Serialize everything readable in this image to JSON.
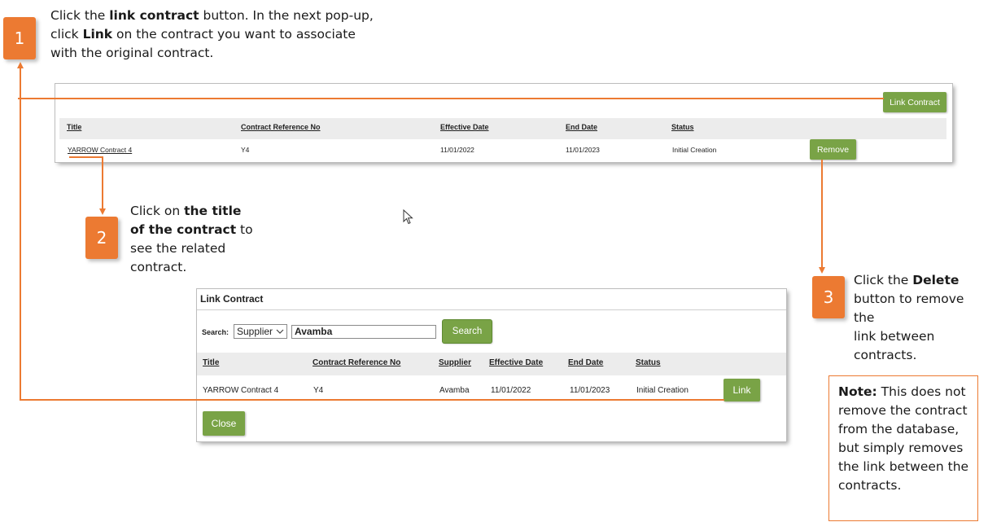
{
  "step1": {
    "number": "1",
    "line1_pre": "Click the ",
    "line1_bold": "link contract",
    "line1_post": " button. In the next pop-up,",
    "line2_pre": "click ",
    "line2_bold": "Link",
    "line2_post": " on the contract you want to associate",
    "line3": "with the original contract."
  },
  "step2": {
    "number": "2",
    "line1_pre": "Click on ",
    "line1_bold": "the title",
    "line2_bold": "of the contract",
    "line2_post": " to",
    "line3": "see the related",
    "line4": "contract."
  },
  "step3": {
    "number": "3",
    "line1_pre": "Click the ",
    "line1_bold": "Delete",
    "line2": "button to remove the",
    "line3": "link between",
    "line4": "contracts."
  },
  "note": {
    "bold": "Note:",
    "line1_post": " This does not",
    "line2": "remove the contract",
    "line3": "from the database,",
    "line4": "but simply removes",
    "line5": "the link between the",
    "line6": "contracts."
  },
  "top_panel": {
    "link_contract_button": "Link Contract",
    "headers": [
      "Title",
      "Contract Reference No",
      "Effective Date",
      "End Date",
      "Status"
    ],
    "row": {
      "title": "YARROW Contract 4",
      "ref": "Y4",
      "effective": "11/01/2022",
      "end": "11/01/2023",
      "status": "Initial Creation",
      "remove_button": "Remove"
    }
  },
  "dialog": {
    "title": "Link Contract",
    "search_label": "Search:",
    "search_field_selected": "Supplier",
    "search_value": "Avamba",
    "search_button": "Search",
    "headers": [
      "Title",
      "Contract Reference No",
      "Supplier",
      "Effective Date",
      "End Date",
      "Status"
    ],
    "row": {
      "title": "YARROW Contract 4",
      "ref": "Y4",
      "supplier": "Avamba",
      "effective": "11/01/2022",
      "end": "11/01/2023",
      "status": "Initial Creation",
      "link_button": "Link"
    },
    "close_button": "Close"
  },
  "colors": {
    "accent_orange": "#ec7a32",
    "button_green": "#79a346",
    "header_band": "#ececec"
  }
}
